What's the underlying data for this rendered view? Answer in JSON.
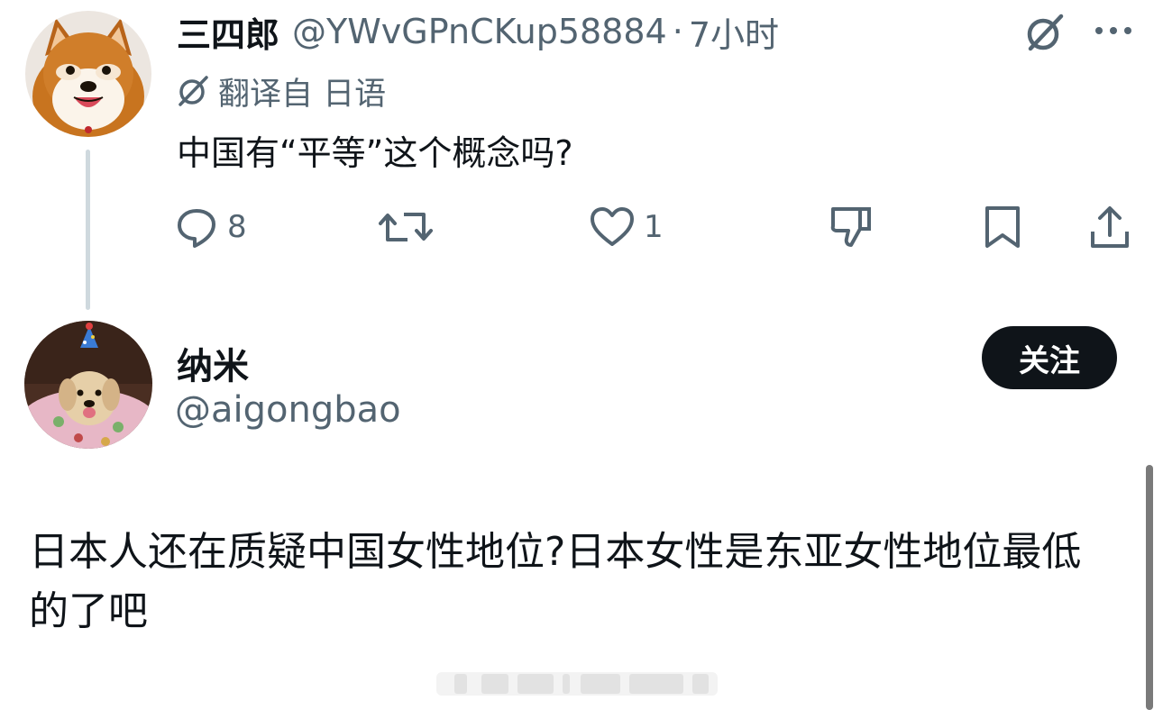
{
  "original_tweet": {
    "display_name": "三四郎",
    "handle": "@YWvGPnCKup58884",
    "separator": "·",
    "time": "7小时",
    "translated_label": "翻译自 日语",
    "text": "中国有“平等”这个概念吗?",
    "reply_count": "8",
    "like_count": "1",
    "icons": [
      "grok-icon",
      "more-icon",
      "translate-icon",
      "reply-icon",
      "retweet-icon",
      "like-icon",
      "dislike-icon",
      "bookmark-icon",
      "share-icon"
    ]
  },
  "reply": {
    "display_name": "纳米",
    "handle": "@aigongbao",
    "follow_label": "关注",
    "text": "日本人还在质疑中国女性地位?日本女性是东亚女性地位最低的了吧"
  },
  "colors": {
    "text_primary": "#0f1419",
    "text_secondary": "#536471",
    "thread_line": "#cfd9de",
    "follow_bg": "#0f1419"
  }
}
